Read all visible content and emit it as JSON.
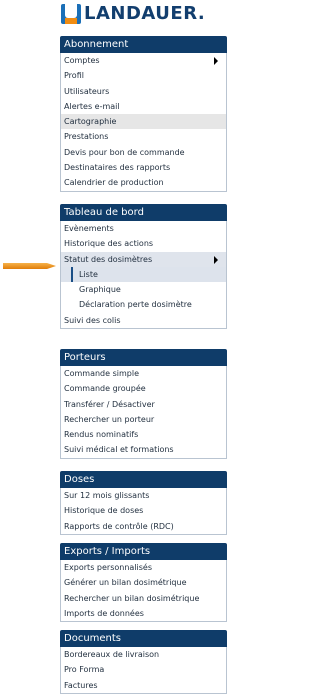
{
  "logo": {
    "text": "LANDAUER."
  },
  "colors": {
    "header": "#0f3c69",
    "logo_blue": "#1b6fb7",
    "accent_orange": "#f08c12"
  },
  "sections": [
    {
      "title": "Abonnement",
      "items": [
        "Comptes",
        "Profil",
        "Utilisateurs",
        "Alertes e-mail",
        "Cartographie",
        "Prestations",
        "Devis pour bon de commande",
        "Destinataires des rapports",
        "Calendrier de production"
      ]
    },
    {
      "title": "Tableau de bord",
      "items": [
        "Evènements",
        "Historique des actions",
        "Statut des dosimètres",
        "Liste",
        "Graphique",
        "Déclaration perte dosimètre",
        "Suivi des colis"
      ]
    },
    {
      "title": "Porteurs",
      "items": [
        "Commande simple",
        "Commande groupée",
        "Transférer / Désactiver",
        "Rechercher un porteur",
        "Rendus nominatifs",
        "Suivi médical et formations"
      ]
    },
    {
      "title": "Doses",
      "items": [
        "Sur 12 mois glissants",
        "Historique de doses",
        "Rapports de contrôle (RDC)"
      ]
    },
    {
      "title": "Exports / Imports",
      "items": [
        "Exports personnalisés",
        "Générer un bilan dosimétrique",
        "Rechercher un bilan dosimétrique",
        "Imports de données"
      ]
    },
    {
      "title": "Documents",
      "items": [
        "Bordereaux de livraison",
        "Pro Forma",
        "Factures"
      ]
    }
  ]
}
